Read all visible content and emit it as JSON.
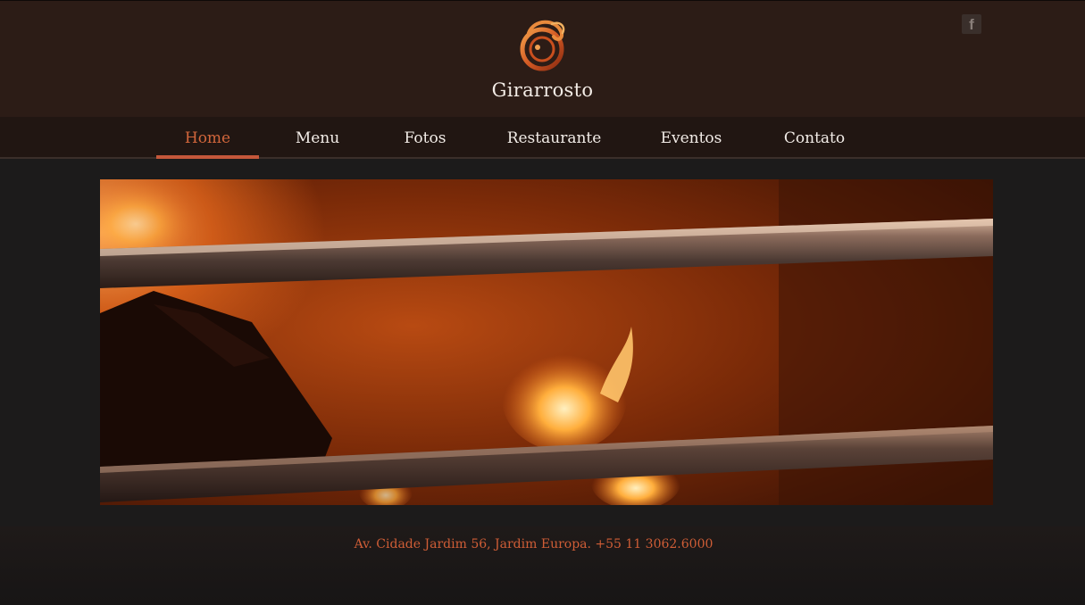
{
  "header": {
    "brand_name": "Girarrosto",
    "logo_icon": "swirl-logo-icon",
    "social": {
      "facebook_label": "f"
    }
  },
  "nav": {
    "items": [
      {
        "label": "Home",
        "active": true
      },
      {
        "label": "Menu",
        "active": false
      },
      {
        "label": "Fotos",
        "active": false
      },
      {
        "label": "Restaurante",
        "active": false
      },
      {
        "label": "Eventos",
        "active": false
      },
      {
        "label": "Contato",
        "active": false
      }
    ]
  },
  "hero": {
    "icon": "fire-grill-image"
  },
  "footer": {
    "address": "Av. Cidade Jardim 56, Jardim Europa. +55 11 3062.6000"
  },
  "colors": {
    "header_bg": "#2c1c16",
    "nav_bg": "#211612",
    "accent": "#cf5d36",
    "page_bg": "#1c1b1b"
  }
}
